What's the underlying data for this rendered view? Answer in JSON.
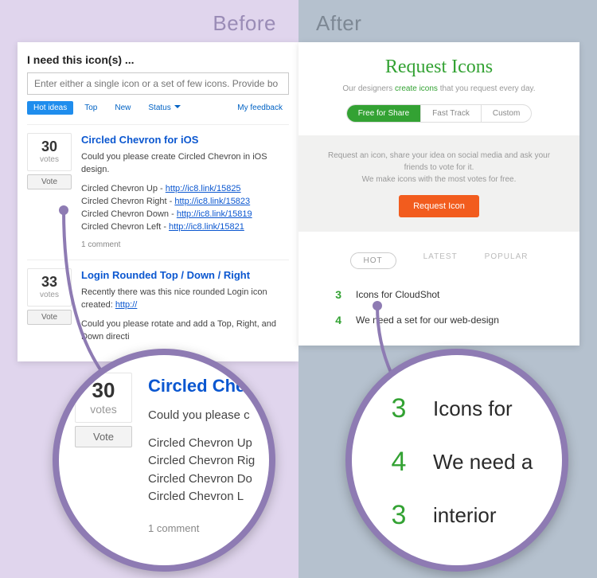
{
  "labels": {
    "before": "Before",
    "after": "After"
  },
  "before": {
    "heading": "I need this icon(s) ...",
    "search_placeholder": "Enter either a single icon or a set of few icons. Provide bo",
    "tabs": {
      "hot": "Hot ideas",
      "top": "Top",
      "new": "New",
      "status": "Status",
      "my": "My feedback"
    },
    "ideas": [
      {
        "votes": "30",
        "votes_label": "votes",
        "vote_btn": "Vote",
        "title": "Circled Chevron for iOS",
        "desc": "Could you please create Circled Chevron in iOS design.",
        "lines": [
          {
            "text": "Circled Chevron Up - ",
            "link": "http://ic8.link/15825"
          },
          {
            "text": "Circled Chevron Right - ",
            "link": "http://ic8.link/15823"
          },
          {
            "text": "Circled Chevron Down - ",
            "link": "http://ic8.link/15819"
          },
          {
            "text": "Circled Chevron Left - ",
            "link": "http://ic8.link/15821"
          }
        ],
        "comment": "1 comment"
      },
      {
        "votes": "33",
        "votes_label": "votes",
        "vote_btn": "Vote",
        "title": "Login Rounded Top / Down / Right",
        "desc_prefix": "Recently there was this nice rounded Login icon created: ",
        "desc_link": "http://",
        "desc2": "Could you please rotate and add a Top, Right, and Down directi"
      }
    ]
  },
  "after": {
    "title": "Request Icons",
    "subtitle_pre": "Our designers ",
    "subtitle_link": "create icons",
    "subtitle_post": " that you request every day.",
    "segtabs": {
      "free": "Free for Share",
      "fast": "Fast Track",
      "custom": "Custom"
    },
    "grey_line1": "Request an icon, share your idea on social media and ask your friends to vote for it.",
    "grey_line2": "We make icons with the most votes for free.",
    "request_btn": "Request Icon",
    "sorttabs": {
      "hot": "HOT",
      "latest": "LATEST",
      "popular": "POPULAR"
    },
    "requests": [
      {
        "num": "3",
        "text": "Icons for CloudShot"
      },
      {
        "num": "4",
        "text": "We need a set for our web-design"
      }
    ]
  },
  "mag_before": {
    "votes": "30",
    "votes_label": "votes",
    "vote_btn": "Vote",
    "title": "Circled Che",
    "desc": "Could you please c",
    "lines": [
      "Circled Chevron Up",
      "Circled Chevron Rig",
      "Circled Chevron Do",
      "Circled Chevron L"
    ],
    "comment": "1 comment"
  },
  "mag_after": {
    "rows": [
      {
        "num": "3",
        "text": "Icons for"
      },
      {
        "num": "4",
        "text": "We need a"
      },
      {
        "num": "3",
        "text": "interior"
      }
    ]
  }
}
